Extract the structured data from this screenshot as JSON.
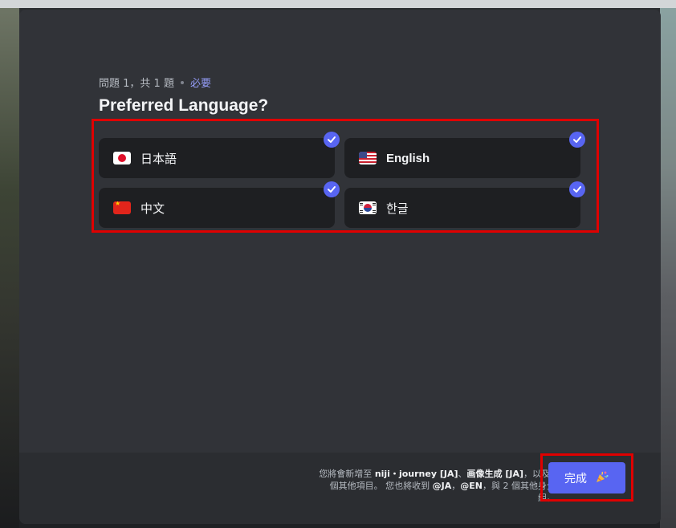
{
  "question": {
    "counter": "問題 1，共 1 題",
    "required": "必要",
    "title": "Preferred Language?"
  },
  "options": [
    {
      "label": "日本語",
      "flag": "japan-flag-icon",
      "checked": true
    },
    {
      "label": "English",
      "flag": "us-flag-icon",
      "checked": true
    },
    {
      "label": "中文",
      "flag": "china-flag-icon",
      "checked": true
    },
    {
      "label": "한글",
      "flag": "korea-flag-icon",
      "checked": true
    }
  ],
  "footer": {
    "line1_prefix": "您將會新增至 ",
    "server_name": "niji・journey [JA]",
    "sep": "、",
    "channel_name": "画像生成 [JA]",
    "line1_suffix": "，以及6",
    "line2_prefix": "個其他項目。 您也將收到 ",
    "role1": "@JA",
    "comma": "，",
    "role2": "@EN",
    "line2_suffix": "，與 2 個其他身分",
    "line3": "組。"
  },
  "done_button": {
    "label": "完成",
    "icon": "party-popper-icon"
  },
  "colors": {
    "accent": "#5865f2",
    "highlight": "#e00000",
    "modal": "#313338"
  }
}
